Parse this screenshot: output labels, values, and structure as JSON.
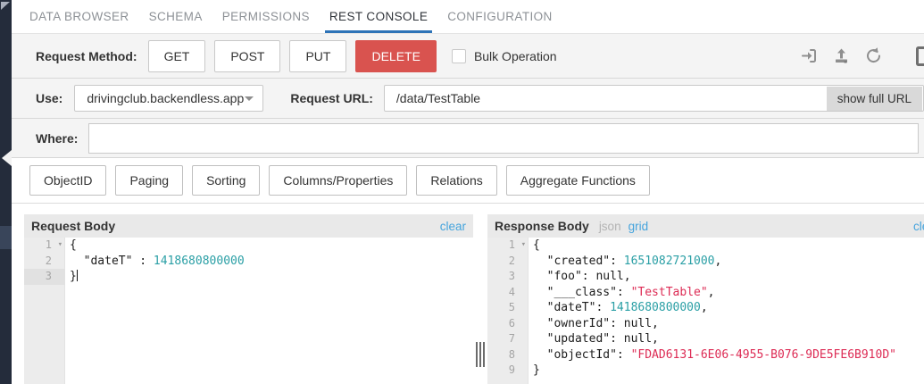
{
  "colors": {
    "accent_blue": "#2d73b7",
    "link_blue": "#45a4dd",
    "delete_red": "#d9534f",
    "code_number_teal": "#2a9fa5",
    "code_string_red": "#dd2c55",
    "row_bg": "#f4f4f4",
    "sidebar_bg": "#242c3b"
  },
  "tabs": {
    "items": [
      {
        "label": "DATA BROWSER",
        "active": false
      },
      {
        "label": "SCHEMA",
        "active": false
      },
      {
        "label": "PERMISSIONS",
        "active": false
      },
      {
        "label": "REST CONSOLE",
        "active": true
      },
      {
        "label": "CONFIGURATION",
        "active": false
      }
    ]
  },
  "method_row": {
    "label": "Request Method:",
    "buttons": [
      {
        "label": "GET",
        "selected": false
      },
      {
        "label": "POST",
        "selected": false
      },
      {
        "label": "PUT",
        "selected": false
      },
      {
        "label": "DELETE",
        "selected": true
      }
    ],
    "bulk_checkbox": {
      "label": "Bulk Operation",
      "checked": false
    },
    "icons": {
      "left": "login-icon",
      "middle": "upload-icon",
      "right": "undo-icon"
    }
  },
  "use_row": {
    "label": "Use:",
    "app_select": {
      "value": "drivingclub.backendless.app"
    },
    "url_label": "Request URL:",
    "url_input": {
      "value": "/data/TestTable",
      "placeholder": ""
    },
    "show_full_url_button": "show full URL"
  },
  "where_row": {
    "label": "Where:",
    "input_value": ""
  },
  "query_options": {
    "buttons": [
      "ObjectID",
      "Paging",
      "Sorting",
      "Columns/Properties",
      "Relations",
      "Aggregate Functions"
    ]
  },
  "request_body": {
    "title": "Request Body",
    "clear_link": "clear",
    "code": {
      "lines": [
        {
          "num": "1",
          "fold": true,
          "segments": [
            [
              "p",
              "{"
            ]
          ]
        },
        {
          "num": "2",
          "segments": [
            [
              "p",
              "  \"dateT\" : "
            ],
            [
              "n",
              "1418680800000"
            ]
          ]
        },
        {
          "num": "3",
          "cursor": true,
          "segments": [
            [
              "p",
              "}"
            ]
          ]
        }
      ]
    }
  },
  "response_body": {
    "title": "Response Body",
    "mode_json": "json",
    "mode_grid": "grid",
    "clear_link": "clear",
    "code": {
      "lines": [
        {
          "num": "1",
          "fold": true,
          "segments": [
            [
              "p",
              "{"
            ]
          ]
        },
        {
          "num": "2",
          "segments": [
            [
              "p",
              "  \"created\": "
            ],
            [
              "n",
              "1651082721000"
            ],
            [
              "p",
              ","
            ]
          ]
        },
        {
          "num": "3",
          "segments": [
            [
              "p",
              "  \"foo\": null,"
            ]
          ]
        },
        {
          "num": "4",
          "segments": [
            [
              "p",
              "  \"___class\": "
            ],
            [
              "s",
              "\"TestTable\""
            ],
            [
              "p",
              ","
            ]
          ]
        },
        {
          "num": "5",
          "segments": [
            [
              "p",
              "  \"dateT\": "
            ],
            [
              "n",
              "1418680800000"
            ],
            [
              "p",
              ","
            ]
          ]
        },
        {
          "num": "6",
          "segments": [
            [
              "p",
              "  \"ownerId\": null,"
            ]
          ]
        },
        {
          "num": "7",
          "segments": [
            [
              "p",
              "  \"updated\": null,"
            ]
          ]
        },
        {
          "num": "8",
          "segments": [
            [
              "p",
              "  \"objectId\": "
            ],
            [
              "s",
              "\"FDAD6131-6E06-4955-B076-9DE5FE6B910D\""
            ]
          ]
        },
        {
          "num": "9",
          "segments": [
            [
              "p",
              "}"
            ]
          ]
        }
      ]
    }
  }
}
